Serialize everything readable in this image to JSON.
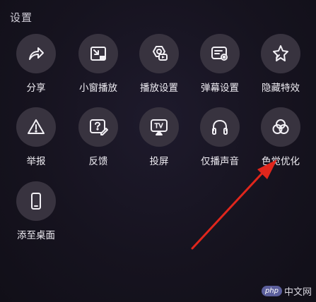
{
  "panel": {
    "title": "设置"
  },
  "items": [
    {
      "label": "分享",
      "icon": "share-icon"
    },
    {
      "label": "小窗播放",
      "icon": "mini-window-icon"
    },
    {
      "label": "播放设置",
      "icon": "playback-settings-icon"
    },
    {
      "label": "弹幕设置",
      "icon": "danmaku-settings-icon"
    },
    {
      "label": "隐藏特效",
      "icon": "hide-effects-icon"
    },
    {
      "label": "举报",
      "icon": "report-icon"
    },
    {
      "label": "反馈",
      "icon": "feedback-icon"
    },
    {
      "label": "投屏",
      "icon": "cast-screen-icon"
    },
    {
      "label": "仅播声音",
      "icon": "audio-only-icon"
    },
    {
      "label": "色觉优化",
      "icon": "color-vision-icon"
    },
    {
      "label": "添至桌面",
      "icon": "add-to-desktop-icon"
    }
  ],
  "watermark": {
    "badge": "php",
    "text": "中文网"
  },
  "annotation": {
    "color": "#e0261c"
  }
}
